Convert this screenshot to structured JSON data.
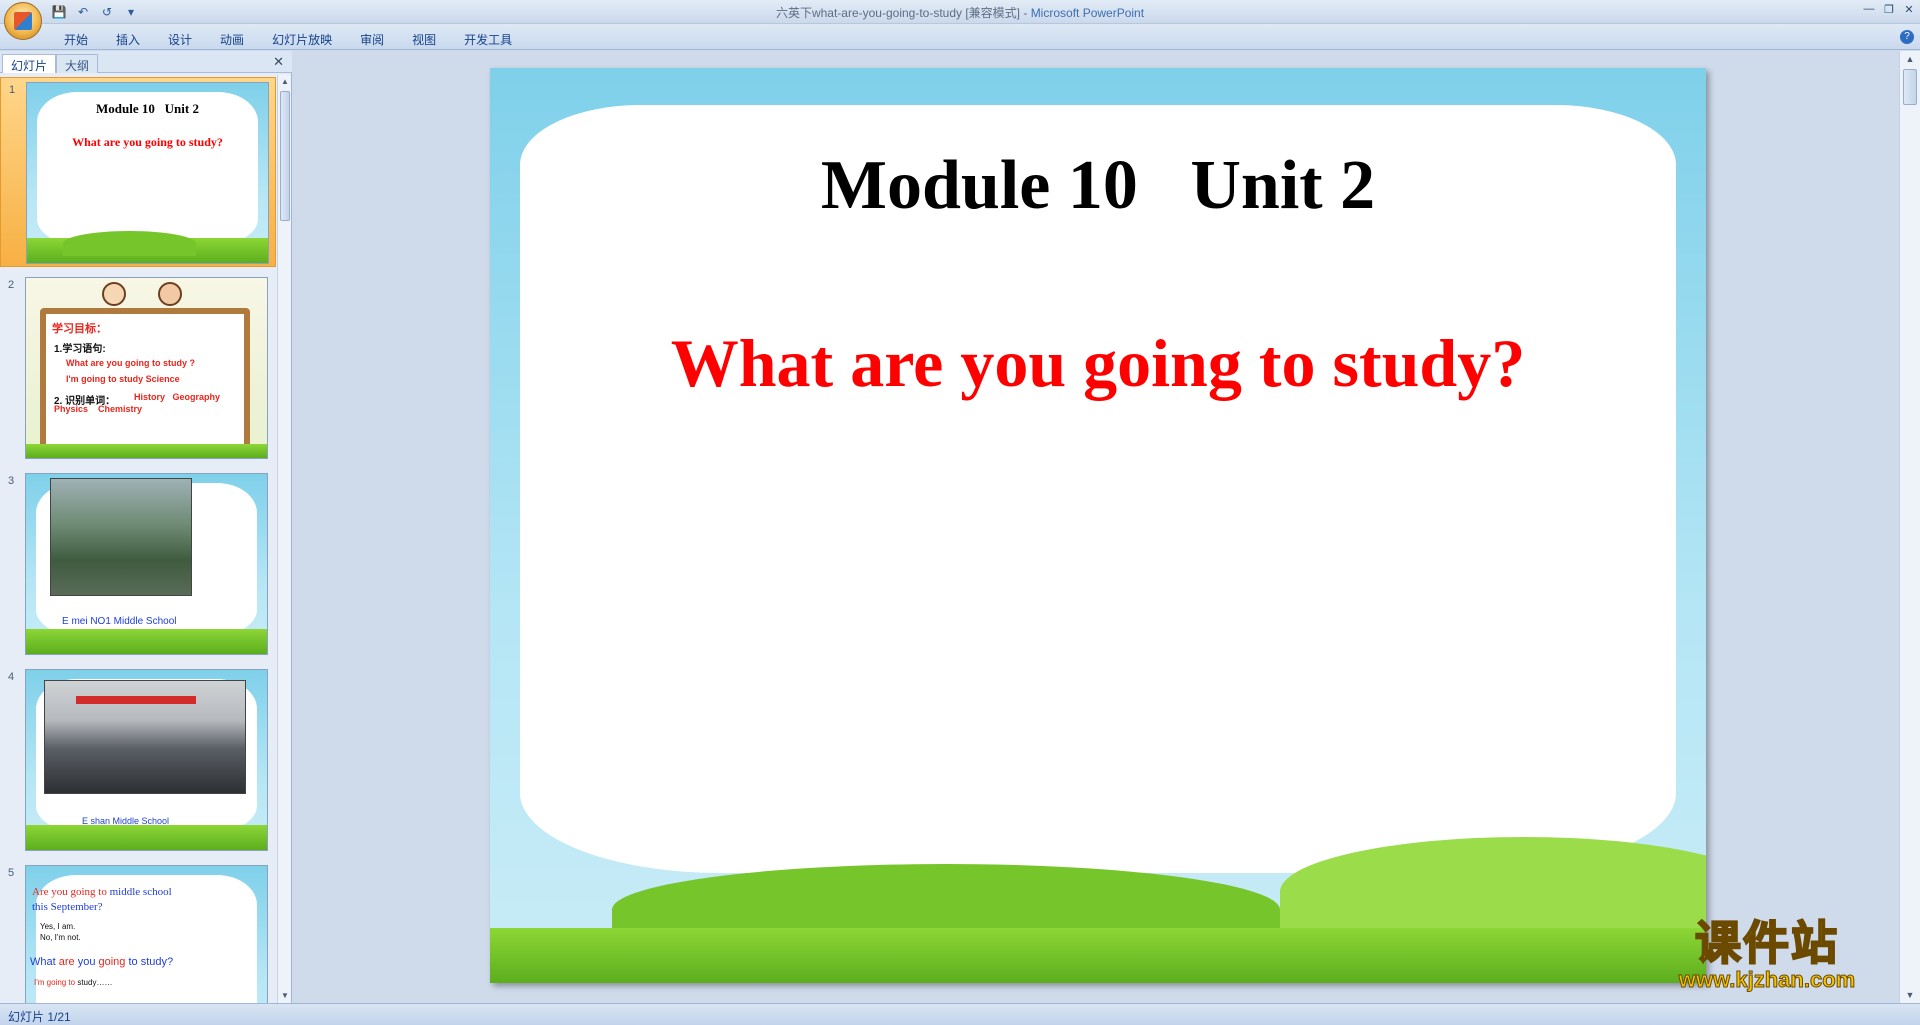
{
  "window": {
    "title_doc": "六英下what-are-you-going-to-study [兼容模式]",
    "title_sep": " - ",
    "title_app": "Microsoft PowerPoint"
  },
  "ribbon": {
    "tabs": [
      "开始",
      "插入",
      "设计",
      "动画",
      "幻灯片放映",
      "审阅",
      "视图",
      "开发工具"
    ]
  },
  "panel": {
    "tab_slides": "幻灯片",
    "tab_outline": "大纲"
  },
  "slides": [
    {
      "num": "1",
      "title": "Module 10   Unit 2",
      "subtitle": "What are you going to study?"
    },
    {
      "num": "2",
      "heading": "学习目标：",
      "line1": "1.学习语句:",
      "line2": "What are you going to study ?",
      "line3": "I'm going to study Science",
      "line4_label": "2. 识别单词：",
      "line4_words": "History   Geography",
      "line5": "Physics    Chemistry"
    },
    {
      "num": "3",
      "caption": "E mei NO1 Middle School"
    },
    {
      "num": "4",
      "caption": "E shan Middle School"
    },
    {
      "num": "5",
      "line1_a": "Are you going to ",
      "line1_b": "middle school",
      "line2": "this September?",
      "line3": "Yes, I am.",
      "line4": "No, I'm not.",
      "line5_a": "What ",
      "line5_b": "are",
      "line5_c": " you ",
      "line5_d": "going",
      "line5_e": " to ",
      "line5_f": "study?",
      "line6_a": "I'm going to ",
      "line6_b": "study……"
    }
  ],
  "main_slide": {
    "title": "Module 10   Unit 2",
    "subtitle": "What are you going to study?"
  },
  "status": {
    "text": "幻灯片 1/21"
  },
  "watermark": {
    "cn": "课件站",
    "url": "www.kjzhan.com"
  },
  "colors": {
    "title_red": "#ff0000",
    "link_blue": "#1f3fd6",
    "selected_slide": "#f7b044"
  }
}
